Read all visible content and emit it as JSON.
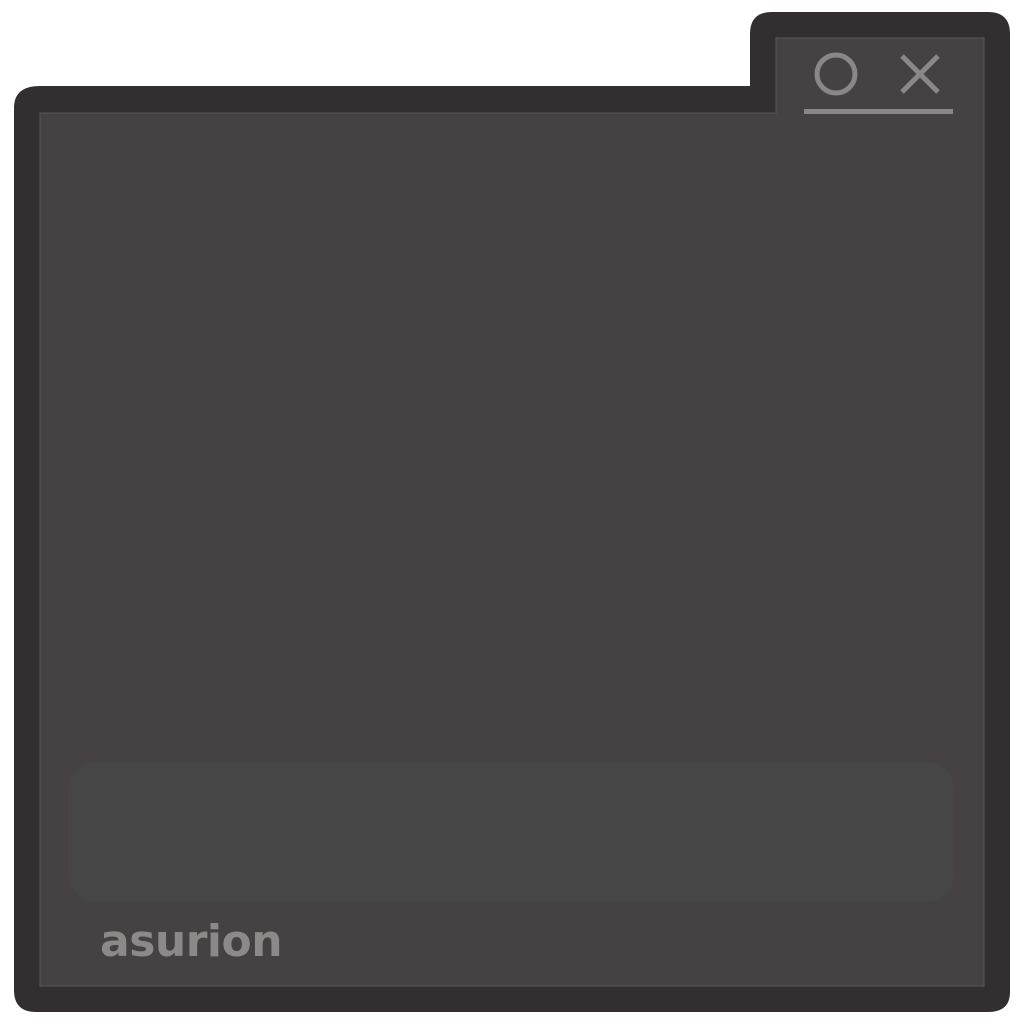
{
  "brand": {
    "name": "asurion"
  },
  "window": {
    "frame_color": "#332e2f",
    "body_color": "#464244",
    "panel_color": "#464646",
    "control_color": "#8a8787"
  },
  "controls": {
    "minimize_icon": "circle-icon",
    "close_icon": "x-icon"
  }
}
